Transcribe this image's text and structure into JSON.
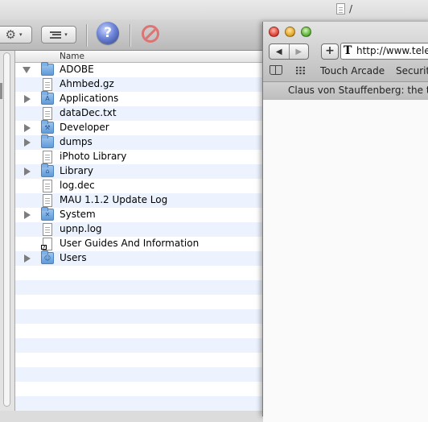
{
  "finder": {
    "window_title": "/",
    "toolbar": {
      "action_caret": "▾",
      "arrange_caret": "▾",
      "help_label": "?"
    },
    "column_header": "Name",
    "items": [
      {
        "name": "ADOBE",
        "kind": "folder",
        "disclosure": "open"
      },
      {
        "name": "Ahmbed.gz",
        "kind": "file",
        "disclosure": "none"
      },
      {
        "name": "Applications",
        "kind": "folder",
        "disclosure": "closed"
      },
      {
        "name": "dataDec.txt",
        "kind": "file",
        "disclosure": "none"
      },
      {
        "name": "Developer",
        "kind": "folder",
        "disclosure": "closed"
      },
      {
        "name": "dumps",
        "kind": "folder",
        "disclosure": "closed"
      },
      {
        "name": "iPhoto Library",
        "kind": "file",
        "disclosure": "none"
      },
      {
        "name": "Library",
        "kind": "folder",
        "disclosure": "closed"
      },
      {
        "name": "log.dec",
        "kind": "file",
        "disclosure": "none"
      },
      {
        "name": "MAU 1.1.2 Update Log",
        "kind": "file",
        "disclosure": "none"
      },
      {
        "name": "System",
        "kind": "folder",
        "disclosure": "closed"
      },
      {
        "name": "upnp.log",
        "kind": "file",
        "disclosure": "none"
      },
      {
        "name": "User Guides And Information",
        "kind": "alias",
        "disclosure": "none"
      },
      {
        "name": "Users",
        "kind": "folder",
        "disclosure": "closed"
      }
    ]
  },
  "safari": {
    "back_label": "◀",
    "forward_label": "▶",
    "add_label": "+",
    "site_icon_letter": "T",
    "url": "http://www.tele",
    "bookmarks": [
      "Touch Arcade",
      "Security"
    ],
    "tab_title": "Claus von Stauffenberg: the tru"
  },
  "colors": {
    "row_alt": "#edf3fe",
    "folder_blue": "#6fa6df",
    "close": "#e2473a",
    "minimize": "#e7a92e",
    "zoom": "#63b63d"
  }
}
